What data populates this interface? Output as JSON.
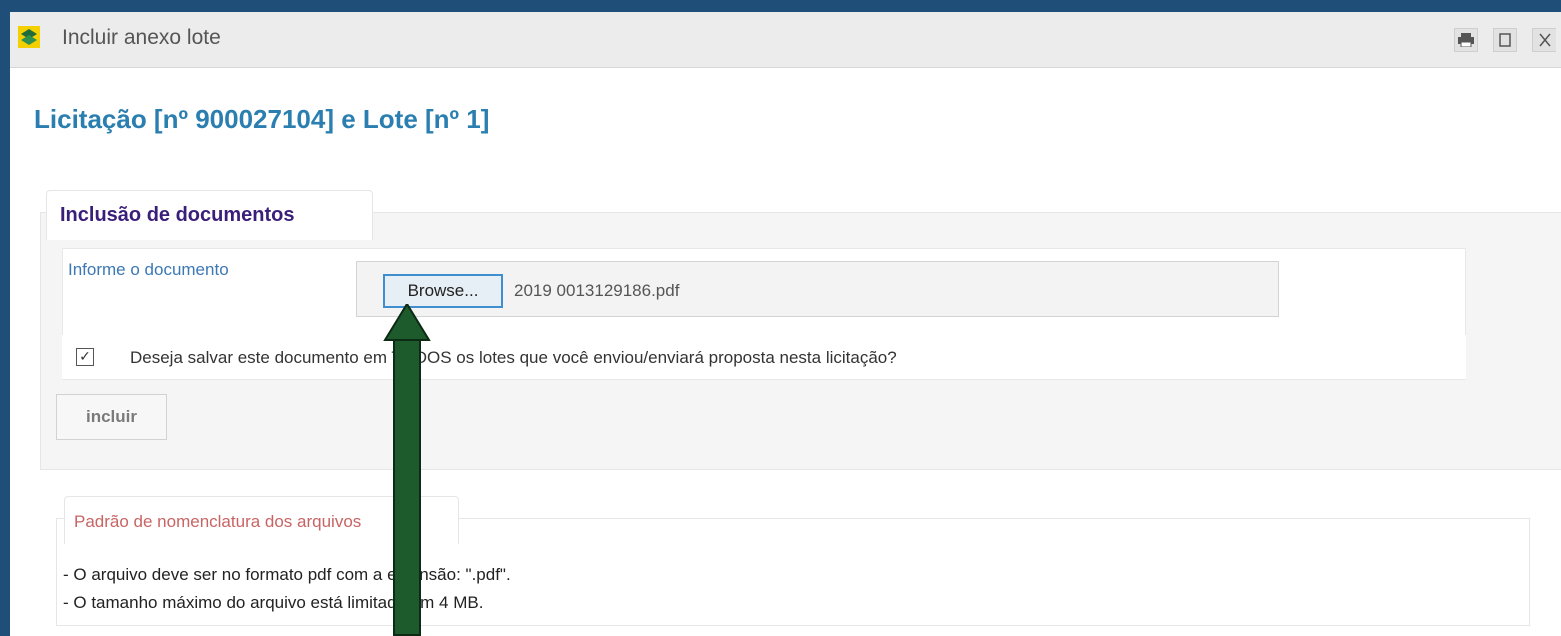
{
  "window": {
    "title": "Incluir anexo lote",
    "buttons": {
      "print_icon": "printer-icon",
      "maximize_icon": "maximize-icon",
      "close_icon": "close-icon"
    }
  },
  "page": {
    "title": "Licitação [nº 900027104] e Lote [nº 1]"
  },
  "upload_panel": {
    "tab_label": "Inclusão de documentos",
    "field_label": "Informe o documento",
    "browse_label": "Browse...",
    "file_name": "2019 0013129186.pdf",
    "save_all_checked": true,
    "save_all_label": "Deseja salvar este documento em TODOS os lotes que você enviou/enviará proposta nesta licitação?",
    "submit_label": "incluir"
  },
  "naming_rules": {
    "title": "Padrão de nomenclatura dos arquivos",
    "lines": [
      "- O arquivo deve ser no formato pdf com a extensão: \".pdf\".",
      "- O tamanho máximo do arquivo está limitado em 4 MB."
    ]
  },
  "annotation": {
    "arrow_icon": "up-arrow-icon",
    "arrow_color": "#1d5a2c"
  },
  "colors": {
    "background": "#1f4e79",
    "page_title": "#2a7fb0",
    "tab_label": "#3a1f7a",
    "field_label": "#3c78b4",
    "naming_title": "#c86464"
  }
}
